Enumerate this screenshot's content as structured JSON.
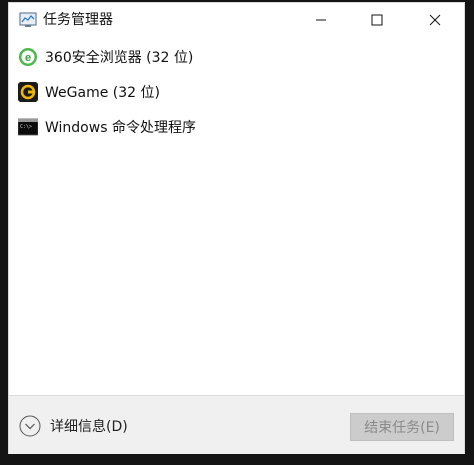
{
  "window": {
    "title": "任务管理器"
  },
  "processes": [
    {
      "label": "360安全浏览器 (32 位)",
      "icon": "360-browser-icon"
    },
    {
      "label": "WeGame (32 位)",
      "icon": "wegame-icon"
    },
    {
      "label": "Windows 命令处理程序",
      "icon": "cmd-icon"
    }
  ],
  "footer": {
    "details_label": "详细信息(D)",
    "end_task_label": "结束任务(E)"
  },
  "colors": {
    "background": "#ffffff",
    "footer": "#f0f0f0",
    "disabled_button": "#cccccc",
    "disabled_text": "#8a8a8a"
  }
}
